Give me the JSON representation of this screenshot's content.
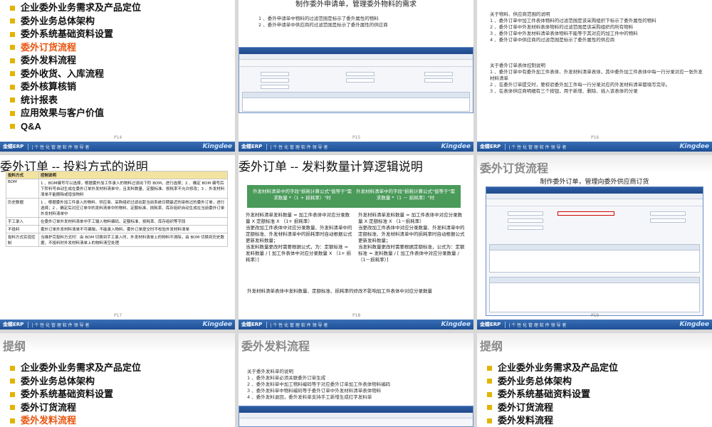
{
  "footer": {
    "erp": "金蝶ERP",
    "tagline": "| 个 性 化 管 理 软 件 领 导 者",
    "logo": "Kingdee"
  },
  "s1": {
    "items": [
      "企业委外业务需求及产品定位",
      "委外业务总体架构",
      "委外系统基础资料设置",
      "委外订货流程",
      "委外发料流程",
      "委外收货、入库流程",
      "委外核算核销",
      "统计报表",
      "应用效果与客户价值",
      "Q&A"
    ],
    "highlight_index": 3,
    "page": "P14"
  },
  "s2": {
    "title": "制作委外申请单，管理委外物料的需求",
    "notes": [
      "1 、委外申请单中物料的过滤范围是标示了委外属性的物料",
      "2 、委外申请单中供应商的过滤范围是标示了委外属性的供应商"
    ],
    "page": "P15"
  },
  "s3": {
    "notes1_title": "关于物料、供应商范围的说明",
    "notes1": [
      "1 、委外订单中加工件表体物料的过滤范围是该采购组织下标示了委外属性的物料",
      "2 、委外订单中外发材料表体物料的过滤范围是该采购组织的所有物料",
      "3 、委外订单中外发材料清单表体物料不能等于其对应的加工件中的物料",
      "4 、委外订单中供应商的过滤范围是标示了委外属性的供应商"
    ],
    "notes2_title": "关于委外订单表体控制说明",
    "notes2": [
      "1 、委外订单中有委外加工件表体、外发材料清单表体，其中委外加工件表体中每一行分录对应一张外发材料清单",
      "2 、在委外订单提交时，要校验委外加工件每一行分录对应的外发材料清单都填写完毕。",
      "3 、在表体供应商明细有三个按钮，用于新增、删除、插入该表体的分录"
    ],
    "page": "P16"
  },
  "s4": {
    "title": "委外订单 -- 投料方式的说明",
    "header": [
      "投料方式",
      "控制说明"
    ],
    "rows": [
      [
        "BOM",
        "1 、BOM编号可以选择，根据委外加工件录入的物料过滤出下阶 BOM，进行选择；2 、确定 BOM 编号后下阶料号自动生成在委外订单外发材料清单中，且发料数量、定额标准、损耗率不允许修改；3 、外发材料清单不能删除或增加物料"
      ],
      [
        "历史数据",
        "1 、根据委外加工件录入的物料、供应商、采购组织过滤出距当前系统日期最近的审核过的委外订单，进行选择；2 、确定后对应订单中的发料清单中的物料、定额标准、损耗率、库存组织自动生成在当前委外订单外发材料清单中"
      ],
      [
        "手工录入",
        "在委外订单外发材料清单中手工输入物料编码、定额标准、损耗率、库存组织等字段"
      ],
      [
        "不投料",
        "委外订单外发材料清单不可编辑，不能录入物料，委外订单提交时不校验外发材料清单"
      ],
      [
        "投料方式实现控制",
        "当维护完投料方式时：由 BOM 切换到手工录入时，外发材料清单上的物料不清除，由 BOM 切换到历史数据，不投料时外发材料清单上的物料清空处理"
      ]
    ],
    "page": "P17"
  },
  "s5": {
    "title": "委外订单 -- 发料数量计算逻辑说明",
    "box_left": "外发材料清单中的字段\"损耗计算公式\"值等于\"需求数量 *（1 + 损耗率）\"时",
    "box_right": "外发材料清单中的字段\"损耗计算公式\"值等于\"需求数量 *（1 － 损耗率）\"时",
    "left": [
      "外发材料清单发料数量 = 加工件表体中对应分录数量 X 定额标准 X （1+ 损耗率）",
      "当更改加工件表体中对应分录数量、外发料清单中的定额标准、外发材料清单中的损耗率时自动根据公式更新发料数量；",
      "当发料数量更改时需要根据公式，为：定额标准 = 发料数量 / [ 加工件表体中对应分录数量 X （1+ 损耗率）]"
    ],
    "right": [
      "外发材料清单发料数量 = 加工件表体中对应分录数量 X 定额标准 X （1－损耗率）",
      "当更改加工件表体中对应分录数量、外发料清单中的定额标准、外发材料清单中的损耗率时自动根据公式更新发料数量；",
      "当发料数量更改时需要根据定额标准，公式为：定额标准 = 发料数量 / [ 加工件表体中对应分录数量 /（1－损耗率）]"
    ],
    "footer_note": "外发材料清单表体中发料数量、定额标准、损耗率的修改不影响加工件表体中对应分录数量",
    "page": "P18"
  },
  "s6": {
    "title": "委外订货流程",
    "subtitle": "制作委外订单，管理向委外供应商订货",
    "page": "P19"
  },
  "s7": {
    "title": "提纲",
    "items": [
      "企业委外业务需求及产品定位",
      "委外业务总体架构",
      "委外系统基础资料设置",
      "委外订货流程",
      "委外发料流程"
    ],
    "highlight_index": 4
  },
  "s8": {
    "title": "委外发料流程",
    "notes_title": "关于委外发料单的说明",
    "notes": [
      "1 、委外发料单必须关联委外订单生成",
      "2 、委外发料单中加工物料编码等于对应委外订单加工件表体物料编码",
      "3 、委外发料单中物料编码等于委外订单中外发材料清单表体物料",
      "4 、委外发料退回，委外发料单支持手工新增生成红字发料单"
    ]
  },
  "s9": {
    "title": "提纲",
    "items": [
      "企业委外业务需求及产品定位",
      "委外业务总体架构",
      "委外系统基础资料设置",
      "委外订货流程",
      "委外发料流程"
    ]
  }
}
